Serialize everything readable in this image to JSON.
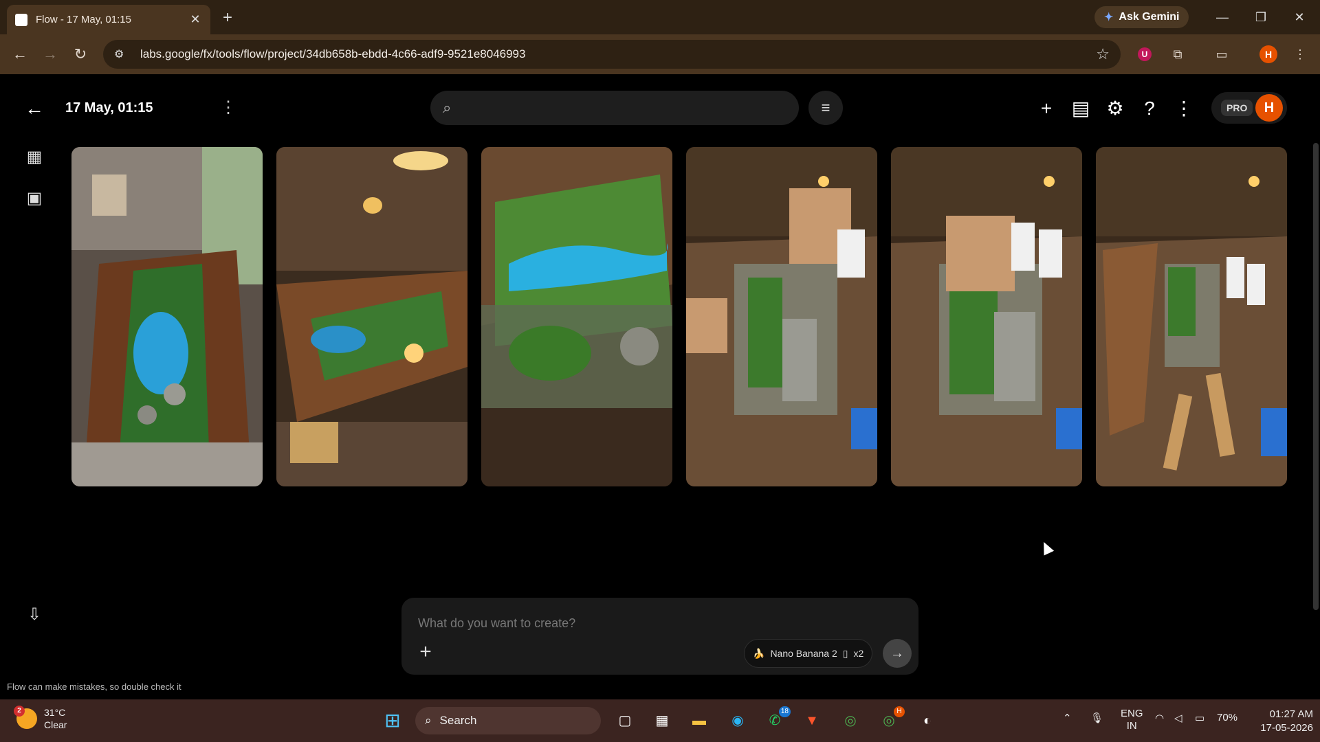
{
  "browser": {
    "tab_title": "Flow - 17 May, 01:15",
    "new_tab_symbol": "+",
    "gemini_label": "Ask Gemini",
    "url": "labs.google/fx/tools/flow/project/34db658b-ebdd-4c66-adf9-9521e8046993",
    "profile_initial": "H",
    "extension_badge": "U"
  },
  "app": {
    "project_title": "17 May, 01:15",
    "search_placeholder": "",
    "pro_label": "PRO",
    "user_initial": "H",
    "gallery": [
      {
        "label": "resin river table in living room"
      },
      {
        "label": "resin river table in workshop with lamp"
      },
      {
        "label": "close-up of moss and water resin"
      },
      {
        "label": "pouring resin over moss"
      },
      {
        "label": "placing moss and stones"
      },
      {
        "label": "workbench with wood slab and tools"
      }
    ],
    "disclaimer": "Flow can make mistakes, so double check it",
    "prompt_placeholder": "What do you want to create?",
    "model_name": "Nano Banana 2",
    "model_count": "x2"
  },
  "taskbar": {
    "weather_temp": "31°C",
    "weather_desc": "Clear",
    "weather_badge": "2",
    "search_label": "Search",
    "whatsapp_badge": "18",
    "chrome_badge": "H",
    "lang_top": "ENG",
    "lang_bottom": "IN",
    "battery": "70%",
    "time": "01:27 AM",
    "date": "17-05-2026"
  }
}
